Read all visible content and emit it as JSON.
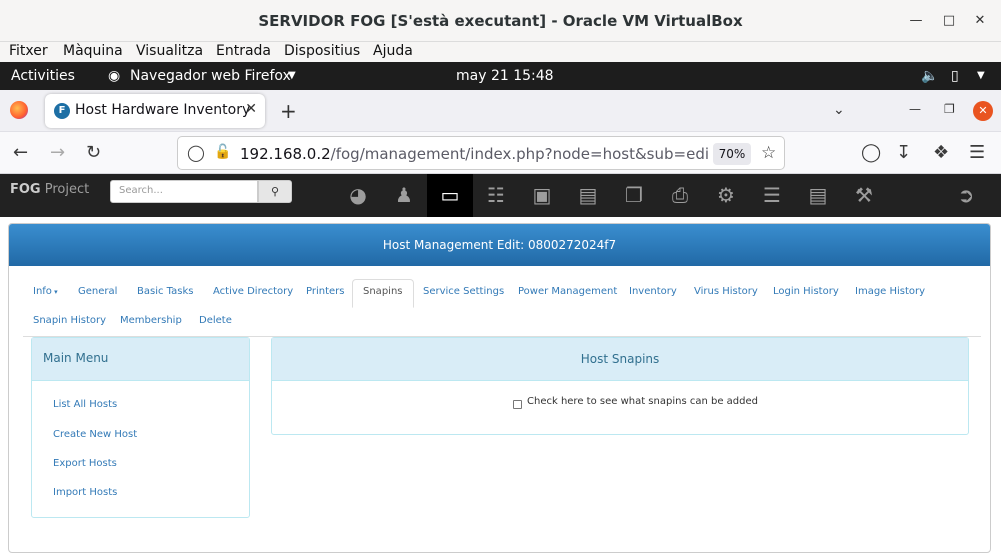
{
  "vbox": {
    "title": "SERVIDOR FOG [S'està executant] - Oracle VM VirtualBox",
    "menu": [
      "Fitxer",
      "Màquina",
      "Visualitza",
      "Entrada",
      "Dispositius",
      "Ajuda"
    ]
  },
  "gnome": {
    "activities": "Activities",
    "app": "Navegador web Firefox",
    "clock": "may 21  15:48"
  },
  "firefox": {
    "tab_title": "Host Hardware Inventory",
    "url_host": "192.168.0.2",
    "url_path": "/fog/management/index.php?node=host&sub=edit&id=",
    "zoom": "70%"
  },
  "fog": {
    "brand_bold": "FOG",
    "brand_rest": " Project",
    "search_placeholder": "Search..."
  },
  "page": {
    "heading": "Host Management Edit: 0800272024f7",
    "tabs_row1": [
      "Info",
      "General",
      "Basic Tasks",
      "Active Directory",
      "Printers",
      "Snapins",
      "Service Settings",
      "Power Management",
      "Inventory",
      "Virus History",
      "Login History",
      "Image History"
    ],
    "tabs_row2": [
      "Snapin History",
      "Membership",
      "Delete"
    ],
    "active_tab": "Snapins",
    "main_menu_title": "Main Menu",
    "main_menu": [
      "List All Hosts",
      "Create New Host",
      "Export Hosts",
      "Import Hosts"
    ],
    "snapins_title": "Host Snapins",
    "snapins_check_label": "Check here to see what snapins can be added"
  }
}
